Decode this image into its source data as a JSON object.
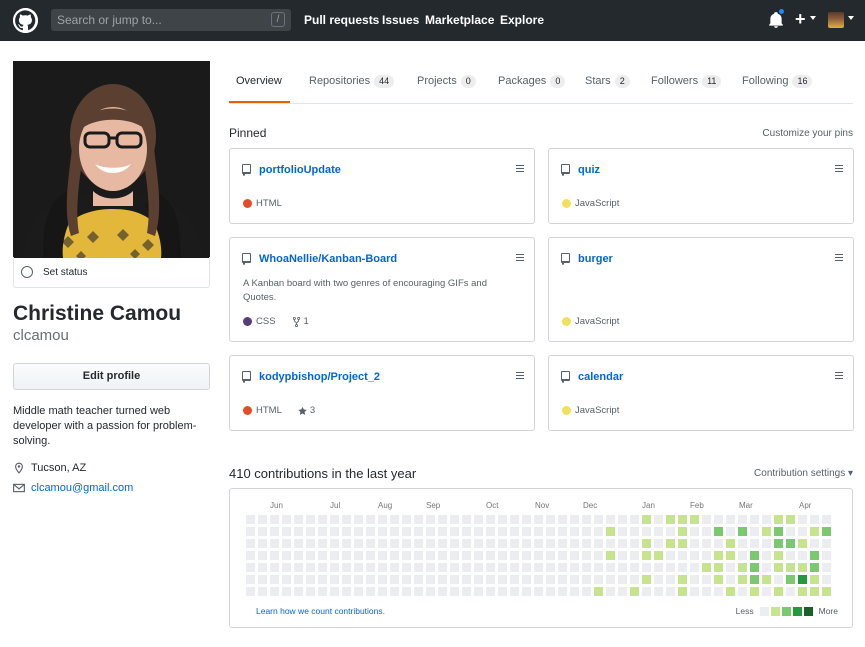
{
  "header": {
    "search_placeholder": "Search or jump to...",
    "search_key": "/",
    "nav": [
      "Pull requests",
      "Issues",
      "Marketplace",
      "Explore"
    ],
    "plus_label": "+"
  },
  "profile": {
    "set_status": "Set status",
    "full_name": "Christine Camou",
    "username": "clcamou",
    "edit_profile": "Edit profile",
    "bio": "Middle math teacher turned web developer with a passion for problem-solving.",
    "location": "Tucson, AZ",
    "email": "clcamou@gmail.com"
  },
  "tabs": [
    {
      "label": "Overview",
      "count": ""
    },
    {
      "label": "Repositories",
      "count": "44"
    },
    {
      "label": "Projects",
      "count": "0"
    },
    {
      "label": "Packages",
      "count": "0"
    },
    {
      "label": "Stars",
      "count": "2"
    },
    {
      "label": "Followers",
      "count": "11"
    },
    {
      "label": "Following",
      "count": "16"
    }
  ],
  "pinned": {
    "title": "Pinned",
    "customize": "Customize your pins",
    "repos": [
      {
        "name": "portfolioUpdate",
        "desc": "",
        "lang": "HTML",
        "lang_color": "#e34c26",
        "extra": ""
      },
      {
        "name": "quiz",
        "desc": "",
        "lang": "JavaScript",
        "lang_color": "#f1e05a",
        "extra": ""
      },
      {
        "name": "WhoaNellie/Kanban-Board",
        "desc": "A Kanban board with two genres of encouraging GIFs and Quotes.",
        "lang": "CSS",
        "lang_color": "#563d7c",
        "extra": "1",
        "extra_icon": "fork-icon"
      },
      {
        "name": "burger",
        "desc": "",
        "lang": "JavaScript",
        "lang_color": "#f1e05a",
        "extra": ""
      },
      {
        "name": "kodypbishop/Project_2",
        "desc": "",
        "lang": "HTML",
        "lang_color": "#e34c26",
        "extra": "3",
        "extra_icon": "star-icon"
      },
      {
        "name": "calendar",
        "desc": "",
        "lang": "JavaScript",
        "lang_color": "#f1e05a",
        "extra": ""
      }
    ]
  },
  "contributions": {
    "title": "410 contributions in the last year",
    "settings": "Contribution settings ▾",
    "months": [
      "Jun",
      "Jul",
      "Aug",
      "Sep",
      "Oct",
      "Nov",
      "Dec",
      "Jan",
      "Feb",
      "Mar",
      "Apr"
    ],
    "learn": "Learn how we count contributions.",
    "legend_less": "Less",
    "legend_more": "More",
    "colors": [
      "#ebedf0",
      "#c6e48b",
      "#7bc96f",
      "#239a3b",
      "#196127"
    ],
    "levels": "000000000000000000000000000000000000000000000000000000000000000000000000000000000000000000000000000000000000000000000000000000000000000000000000000000000000000000000000000000000000000000000000000000000000000001010100000000000000001101101000010001010000111001110000000000100020111000110010200110000222101000101221101102012000101310102211020000100202002300001101001000000000000000000000"
  }
}
